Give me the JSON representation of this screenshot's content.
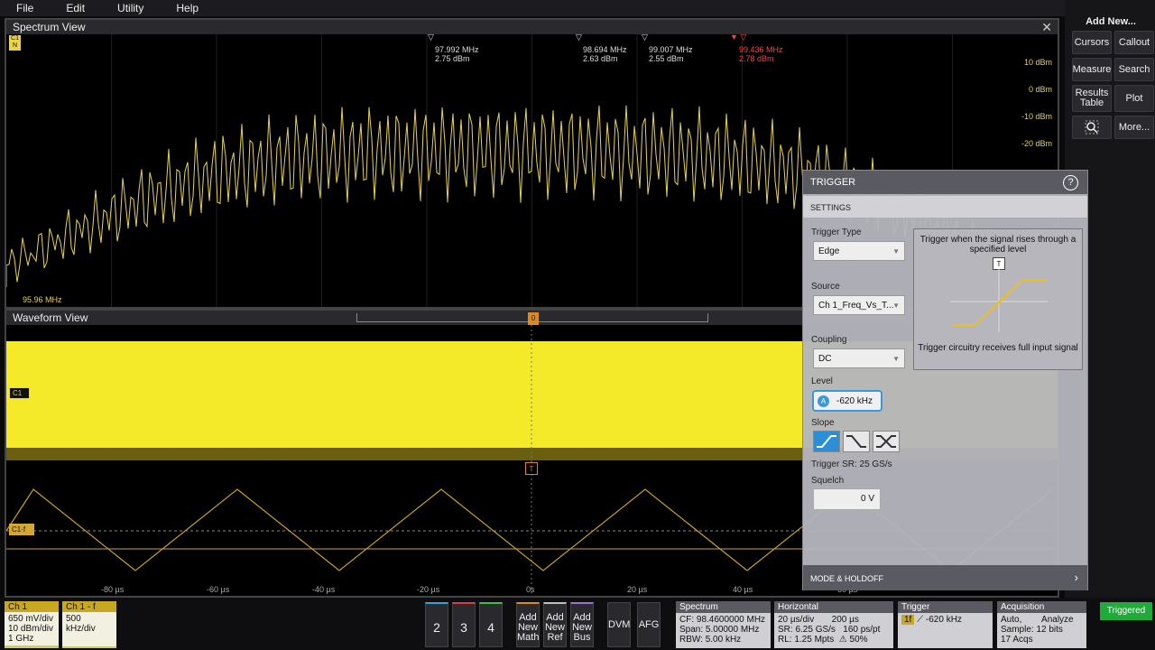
{
  "menu": [
    "File",
    "Edit",
    "Utility",
    "Help"
  ],
  "add_new": {
    "title": "Add New...",
    "buttons": [
      "Cursors",
      "Callout",
      "Measure",
      "Search",
      "Results Table",
      "Plot",
      "More..."
    ]
  },
  "spectrum": {
    "title": "Spectrum View",
    "ch_label": "C1",
    "n_label": "N",
    "start_freq": "95.96 MHz",
    "yticks": [
      "10 dBm",
      "0 dBm",
      "-10 dBm",
      "-20 dBm"
    ],
    "markers": [
      {
        "freq": "97.992 MHz",
        "amp": "2.75 dBm",
        "active": false
      },
      {
        "freq": "98.694 MHz",
        "amp": "2.63 dBm",
        "active": false
      },
      {
        "freq": "99.007 MHz",
        "amp": "2.55 dBm",
        "active": false
      },
      {
        "freq": "99.436 MHz",
        "amp": "2.78 dBm",
        "active": true
      }
    ]
  },
  "waveform": {
    "title": "Waveform View",
    "ch1_label": "C1",
    "ch1f_label": "C1·f",
    "trigger_marker": "T",
    "zero_marker": "0",
    "xticks": [
      "-80 µs",
      "-60 µs",
      "-40 µs",
      "-20 µs",
      "0s",
      "20 µs",
      "40 µs",
      "60 µs"
    ]
  },
  "trigger": {
    "title": "TRIGGER",
    "help": "?",
    "settings": "SETTINGS",
    "type_label": "Trigger Type",
    "type_value": "Edge",
    "source_label": "Source",
    "source_value": "Ch 1_Freq_Vs_T...",
    "coupling_label": "Coupling",
    "coupling_value": "DC",
    "level_label": "Level",
    "level_value": "-620 kHz",
    "level_badge": "A",
    "slope_label": "Slope",
    "slope_selected": "rising",
    "sr": "Trigger SR: 25 GS/s",
    "squelch_label": "Squelch",
    "squelch_value": "0 V",
    "desc_top": "Trigger when the signal rises through a specified level",
    "desc_bottom": "Trigger circuitry receives full input signal",
    "desc_marker": "T",
    "mode_holdoff": "MODE & HOLDOFF"
  },
  "bottom": {
    "ch1": {
      "title": "Ch 1",
      "l1": "650 mV/div",
      "l2": "10 dBm/div",
      "l3": "1 GHz"
    },
    "ch1f": {
      "title": "Ch 1 - f",
      "l1": "500 kHz/div"
    },
    "nums": [
      "2",
      "3",
      "4"
    ],
    "add": [
      "Add New Math",
      "Add New Ref",
      "Add New Bus"
    ],
    "dvm": "DVM",
    "afg": "AFG",
    "spectrum": {
      "title": "Spectrum",
      "body": "CF: 98.4600000 MHz\nSpan: 5.00000 MHz\nRBW: 5.00 kHz"
    },
    "horizontal": {
      "title": "Horizontal",
      "body": "20 µs/div       200 µs\nSR: 6.25 GS/s   160 ps/pt\nRL: 1.25 Mpts  ⚠ 50%"
    },
    "trigger": {
      "title": "Trigger",
      "value": "-620 kHz",
      "badge": "1f"
    },
    "acquisition": {
      "title": "Acquisition",
      "body": "Auto,        Analyze\nSample: 12 bits\n17 Acqs"
    },
    "status": "Triggered"
  },
  "colors": {
    "trace": "#e8d34a",
    "accent": "#2c8ed6",
    "triggered": "#1faa3a"
  }
}
